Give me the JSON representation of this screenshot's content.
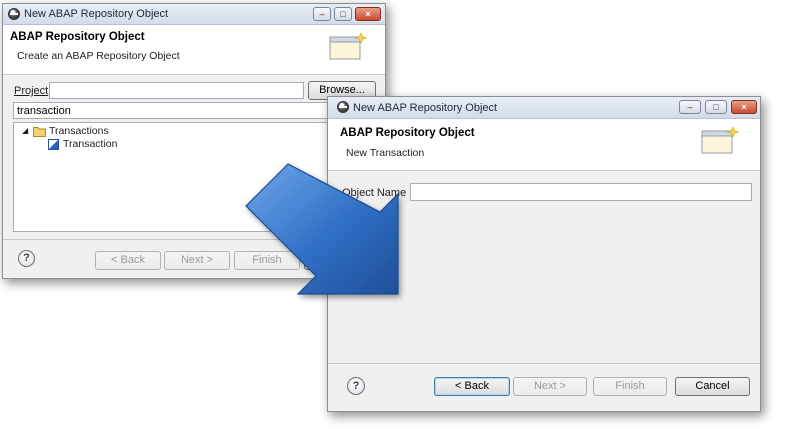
{
  "back_dialog": {
    "title": "New ABAP Repository Object",
    "header_title": "ABAP Repository Object",
    "header_subtitle": "Create an ABAP Repository Object",
    "project_label": "Project",
    "project_value": "",
    "browse_label": "Browse...",
    "filter_value": "transaction",
    "tree": [
      {
        "label": "Transactions",
        "icon": "folder-icon",
        "expanded": true
      },
      {
        "label": "Transaction",
        "icon": "transaction-icon"
      }
    ],
    "buttons": {
      "back": "< Back",
      "next": "Next >",
      "finish": "Finish"
    }
  },
  "front_dialog": {
    "title": "New ABAP Repository Object",
    "header_title": "ABAP Repository Object",
    "header_subtitle": "New Transaction",
    "object_name_label": "Object Name",
    "object_name_value": "",
    "buttons": {
      "back": "< Back",
      "next": "Next >",
      "finish": "Finish",
      "cancel": "Cancel"
    }
  },
  "colors": {
    "arrow": "#2f6fc4",
    "arrow_light": "#6fa8ea",
    "window_bg": "#f0f0f0",
    "close_button": "#c84a2e"
  }
}
